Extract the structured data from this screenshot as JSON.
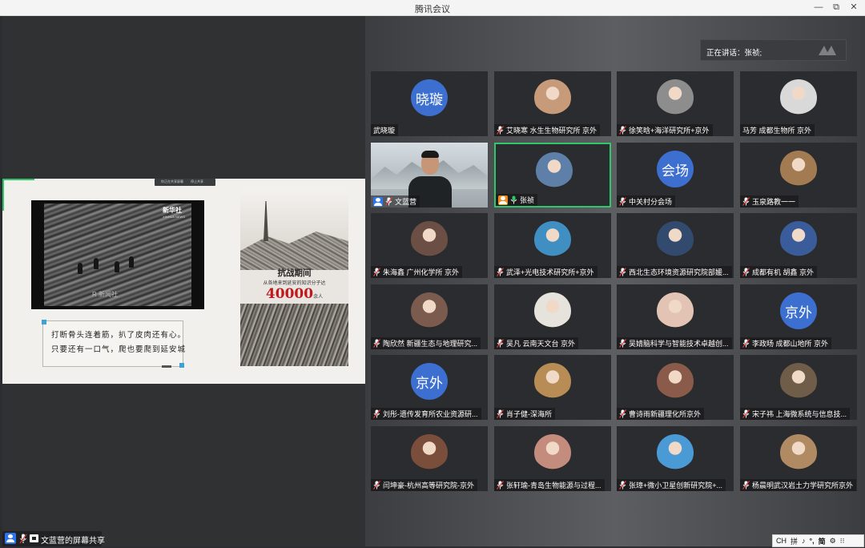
{
  "window": {
    "title": "腾讯会议",
    "min": "—",
    "restore": "⧉",
    "close": "✕"
  },
  "share": {
    "label": "文蓝营的屏幕共享",
    "video_logo": "新华社",
    "video_logo_sub": "XINHUA NEWS",
    "video_caption": "R  新闻社",
    "poem_line1": "打断骨头连着筋，扒了皮肉还有心。",
    "poem_line2": "只要还有一口气，爬也要爬到延安城",
    "poster_title": "抗战期间",
    "poster_subtitle": "从各地来到延安的知识分子达",
    "poster_number": "40000",
    "poster_unit": "余人",
    "toolbar_a": "你正在共享屏幕",
    "toolbar_b": "停止共享"
  },
  "speaking": {
    "text": "正在讲话：张祯;"
  },
  "tiles": [
    {
      "name": "武晓璇",
      "avatar_text": "晓璇",
      "mic": false
    },
    {
      "name": "艾晓寒 水生生物研究所 京外",
      "mic": true,
      "avatar_color": "#c79a7a"
    },
    {
      "name": "徐笑晗+海洋研究所+京外",
      "mic": true,
      "avatar_color": "#8d8d8d"
    },
    {
      "name": "马芳 成都生物所 京外",
      "mic": false,
      "avatar_color": "#d9d9d9"
    },
    {
      "name": "文蓝营",
      "mic": true,
      "video": true
    },
    {
      "name": "张祯",
      "mic": true,
      "active": true,
      "avatar_color": "#5e7fa8"
    },
    {
      "name": "中关村分会场",
      "avatar_text": "会场",
      "mic": true
    },
    {
      "name": "玉泉路教一一",
      "mic": true,
      "avatar_color": "#a37b52"
    },
    {
      "name": "朱海鑫 广州化学所 京外",
      "mic": true,
      "avatar_color": "#6b4f45"
    },
    {
      "name": "武泽+光电技术研究所+京外",
      "mic": true,
      "avatar_color": "#3f8fc2"
    },
    {
      "name": "西北生态环境资源研究院部媛...",
      "mic": true,
      "avatar_color": "#324a6e"
    },
    {
      "name": "成都有机 胡鑫 京外",
      "mic": true,
      "avatar_color": "#3b5c9a"
    },
    {
      "name": "陶欣然 新疆生态与地理研究...",
      "mic": true,
      "avatar_color": "#7a5b4e"
    },
    {
      "name": "吴凡  云南天文台 京外",
      "mic": true,
      "avatar_color": "#e6e2dc"
    },
    {
      "name": "吴婧脑科学与智能技术卓越创...",
      "mic": true,
      "avatar_color": "#e3c4b4"
    },
    {
      "name": "李政旸 成都山地所 京外",
      "avatar_text": "京外",
      "mic": true
    },
    {
      "name": "刘彤-遗传发育所农业资源研...",
      "avatar_text": "京外",
      "mic": true
    },
    {
      "name": "肖子健-深海所",
      "mic": true,
      "avatar_color": "#b78c55"
    },
    {
      "name": "曹诗雨新疆理化所京外",
      "mic": true,
      "avatar_color": "#8a5a4a"
    },
    {
      "name": "宋子祎 上海微系统与信息技...",
      "mic": true,
      "avatar_color": "#6f5d49"
    },
    {
      "name": "闫坤豪-杭州高等研究院-京外",
      "mic": true,
      "avatar_color": "#7a4e3a"
    },
    {
      "name": "张轩瑜-青岛生物能源与过程...",
      "mic": true,
      "avatar_color": "#c48c7c"
    },
    {
      "name": "张璋+微小卫星创新研究院+...",
      "mic": true,
      "avatar_color": "#4a9ad6"
    },
    {
      "name": "杨晨明武汉岩土力学研究所京外",
      "mic": true,
      "avatar_color": "#b08a63"
    }
  ],
  "tray": {
    "a": "CH",
    "b": "拼",
    "c": "♪",
    "d": "°,",
    "e": "简",
    "f": "⚙",
    "g": "⁝⁝"
  },
  "colors": {
    "accent_green": "#2fc76a",
    "avatar_blue": "#3c6fcf",
    "mic_green": "#2fc76a"
  }
}
